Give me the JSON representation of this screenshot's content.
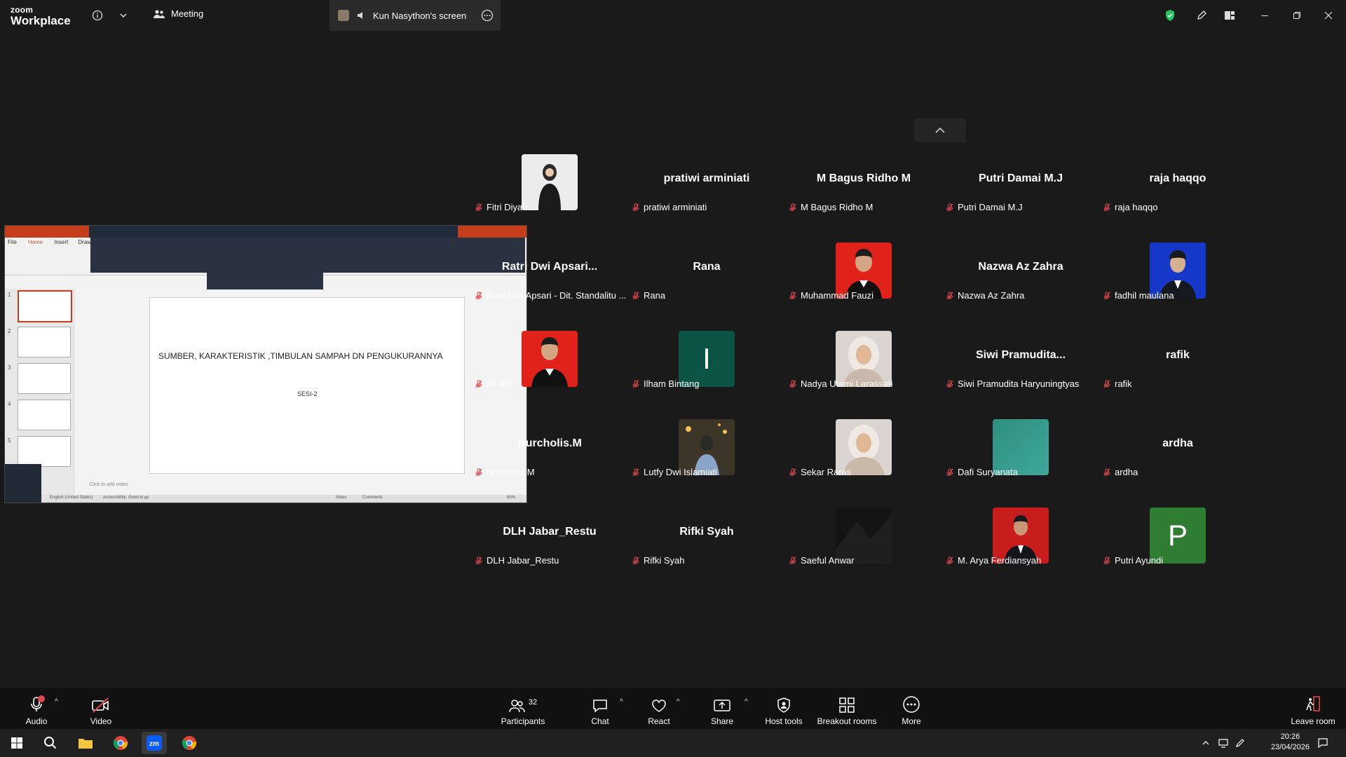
{
  "app": {
    "brand_top": "zoom",
    "brand_bottom": "Workplace",
    "meeting_label": "Meeting",
    "share_tab_label": "Kun Nasython's screen"
  },
  "screenshare": {
    "tabs": [
      "File",
      "Home",
      "Insert",
      "Draw"
    ],
    "slide_title": "SUMBER, KARAKTERISTIK ,TIMBULAN SAMPAH DN PENGUKURANNYA",
    "slide_subtitle": "SESI-2",
    "notes_placeholder": "Click to add notes",
    "status_left": "English (United States)",
    "status_access": "Accessibility: Good to go",
    "status_notes": "Notes",
    "status_comments": "Comments",
    "zoom": "65%",
    "thumb_numbers": [
      "1",
      "2",
      "3",
      "4",
      "5"
    ]
  },
  "participants_grid": [
    {
      "display": "",
      "label": "Fitri Diyah",
      "photo": "photo-woman-hijab"
    },
    {
      "display": "pratiwi arminiati",
      "label": "pratiwi arminiati"
    },
    {
      "display": "M Bagus Ridho M",
      "label": "M Bagus Ridho M"
    },
    {
      "display": "Putri Damai M.J",
      "label": "Putri Damai M.J"
    },
    {
      "display": "raja haqqo",
      "label": "raja haqqo"
    },
    {
      "display": "Ratri  Dwi  Apsari...",
      "label": "Ratri Dwi Apsari - Dit. Standalitu ..."
    },
    {
      "display": "Rana",
      "label": "Rana"
    },
    {
      "display": "",
      "label": "Muhammad Fauzi",
      "photo": "photo-man-red"
    },
    {
      "display": "Nazwa Az Zahra",
      "label": "Nazwa Az Zahra"
    },
    {
      "display": "",
      "label": "fadhil maulana",
      "photo": "photo-man-blue"
    },
    {
      "display": "",
      "label": "Ali Afif",
      "photo": "photo-man-red"
    },
    {
      "display": "",
      "label": "Ilham Bintang",
      "initial": "I",
      "color": "#0b5445"
    },
    {
      "display": "",
      "label": "Nadya Utami Larassati",
      "photo": "photo-woman-hijab-light"
    },
    {
      "display": "Siwi  Pramudita...",
      "label": "Siwi Pramudita Haryuningtyas"
    },
    {
      "display": "rafik",
      "label": "rafik"
    },
    {
      "display": "Nurcholis.M",
      "label": "Nurcholis.M"
    },
    {
      "display": "",
      "label": "Lutfy Dwi Islamiati",
      "photo": "photo-night"
    },
    {
      "display": "",
      "label": "Sekar Raras",
      "photo": "photo-woman-hijab-light"
    },
    {
      "display": "",
      "label": "Dafi Suryanata",
      "photo": "photo-teal"
    },
    {
      "display": "ardha",
      "label": "ardha"
    },
    {
      "display": "DLH Jabar_Restu",
      "label": "DLH Jabar_Restu"
    },
    {
      "display": "Rifki Syah",
      "label": "Rifki Syah"
    },
    {
      "display": "",
      "label": "Saeful Anwar",
      "photo": "photo-dark"
    },
    {
      "display": "",
      "label": "M. Arya Ferdiansyah",
      "photo": "photo-man-suit-red"
    },
    {
      "display": "",
      "label": "Putri Ayundi",
      "initial": "P",
      "color": "#2e7d32"
    }
  ],
  "toolbar": {
    "audio": "Audio",
    "video": "Video",
    "participants": "Participants",
    "participants_count": "32",
    "chat": "Chat",
    "react": "React",
    "share": "Share",
    "host_tools": "Host tools",
    "breakout": "Breakout rooms",
    "more": "More",
    "leave": "Leave room"
  },
  "taskbar": {
    "time": "20:26",
    "date": "23/04/2026"
  },
  "colors": {
    "mic_muted": "#e0474c",
    "shield": "#22c55e",
    "zoom_blue": "#0b5cff"
  }
}
